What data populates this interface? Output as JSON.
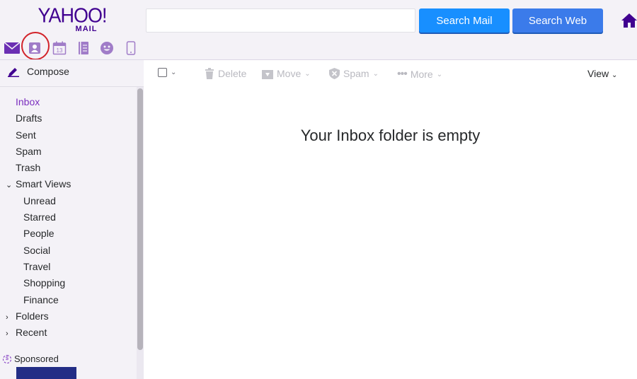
{
  "header": {
    "logo_brand": "YAHOO!",
    "logo_sub": "MAIL",
    "search_value": "",
    "search_mail_label": "Search Mail",
    "search_web_label": "Search Web",
    "app_icons": [
      "mail-icon",
      "contacts-icon",
      "calendar-icon",
      "notepad-icon",
      "messenger-icon",
      "mobile-icon"
    ],
    "calendar_day": "13",
    "accent_color": "#400090"
  },
  "toolbar": {
    "delete_label": "Delete",
    "move_label": "Move",
    "spam_label": "Spam",
    "more_label": "More",
    "view_label": "View"
  },
  "sidebar": {
    "compose_label": "Compose",
    "folders": [
      {
        "label": "Inbox",
        "active": true
      },
      {
        "label": "Drafts"
      },
      {
        "label": "Sent"
      },
      {
        "label": "Spam"
      },
      {
        "label": "Trash"
      },
      {
        "label": "Smart Views",
        "expanded": true
      },
      {
        "label": "Unread"
      },
      {
        "label": "Starred"
      },
      {
        "label": "People"
      },
      {
        "label": "Social"
      },
      {
        "label": "Travel"
      },
      {
        "label": "Shopping"
      },
      {
        "label": "Finance"
      },
      {
        "label": "Folders",
        "expanded": false
      },
      {
        "label": "Recent",
        "expanded": false
      }
    ],
    "sponsored_label": "Sponsored"
  },
  "main": {
    "empty_message": "Your Inbox folder is empty"
  }
}
